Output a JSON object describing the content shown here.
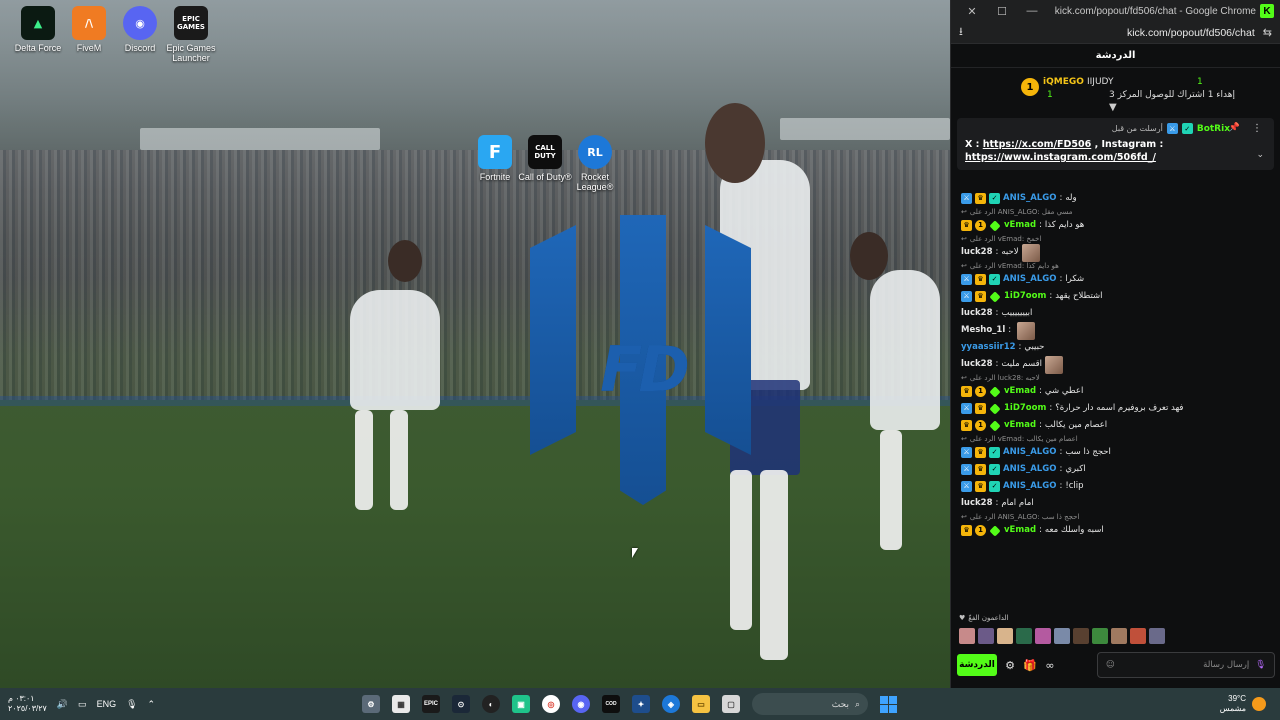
{
  "desktop": {
    "icons": [
      {
        "label": "Delta Force",
        "glyph": "▲"
      },
      {
        "label": "FiveM",
        "glyph": "/\\"
      },
      {
        "label": "Discord",
        "glyph": "◉"
      },
      {
        "label": "Epic Games Launcher",
        "glyph": "EPIC GAMES"
      }
    ],
    "center_icons": [
      {
        "label": "Fortnite",
        "glyph": "F"
      },
      {
        "label": "Call of Duty®",
        "glyph": "CALL DUTY"
      },
      {
        "label": "Rocket League®",
        "glyph": "RL"
      }
    ],
    "logo_text": "FD"
  },
  "browser": {
    "title": "kick.com/popout/fd506/chat - Google Chrome",
    "url": "kick.com/popout/fd506/chat",
    "title_badge": "K"
  },
  "chat": {
    "header": "الدردشة",
    "leaderboard": {
      "rank": "1",
      "user1": "iQMEGO",
      "user1_count": "1",
      "user2": "IIJUDY",
      "user2_count": "1",
      "goal": "إهداء 1 اشتراك للوصول المركز 3"
    },
    "pinned": {
      "pinned_by": "أرسلت من قبل",
      "bot_name": "BotRix",
      "line1_prefix": "X : ",
      "line1_link": "https://x.com/FD506",
      "line1_suffix": " , Instagram :",
      "line2_link": "https://www.instagram.com/506fd_/"
    },
    "messages": [
      {
        "reply": "",
        "user": "ANIS_ALGO",
        "text": "وله",
        "color": "#3a9be8",
        "badges": [
          "mod",
          "crown",
          "bot"
        ],
        "emote": false
      },
      {
        "reply": "الرد على ANIS_ALGO: مسي مقل",
        "user": "vEmad",
        "text": "هو دايم كذا",
        "color": "#53fc18",
        "badges": [
          "crown",
          "one",
          "gift"
        ],
        "emote": false
      },
      {
        "reply": "الرد على vEmad: اخمخ",
        "user": "luck28",
        "text": "لاحبه",
        "color": "#e6e6e6",
        "badges": [],
        "emote": true
      },
      {
        "reply": "الرد على vEmad: هو دايم كذا",
        "user": "ANIS_ALGO",
        "text": "شكرا",
        "color": "#3a9be8",
        "badges": [
          "mod",
          "crown",
          "bot"
        ],
        "emote": false
      },
      {
        "reply": "",
        "user": "1iD7oom",
        "text": "اشتطلاح يقهد",
        "color": "#53fc18",
        "badges": [
          "mod",
          "crown",
          "gift"
        ],
        "emote": false
      },
      {
        "reply": "",
        "user": "luck28",
        "text": "ابيييييييب",
        "color": "#e6e6e6",
        "badges": [],
        "emote": false
      },
      {
        "reply": "",
        "user": "Mesho_1l",
        "text": "",
        "color": "#e6e6e6",
        "badges": [],
        "emote": true
      },
      {
        "reply": "",
        "user": "yyaassiir12",
        "text": "حبيبي",
        "color": "#3a9be8",
        "badges": [],
        "emote": false
      },
      {
        "reply": "",
        "user": "luck28",
        "text": "اقسم مليت",
        "color": "#e6e6e6",
        "badges": [],
        "emote": true
      },
      {
        "reply": "الرد على luck28: لاحبه",
        "user": "vEmad",
        "text": "اعطي شي",
        "color": "#53fc18",
        "badges": [
          "crown",
          "one",
          "gift"
        ],
        "emote": false
      },
      {
        "reply": "",
        "user": "1iD7oom",
        "text": "فهد تعرف بروفيرم اسمه دار حرارة؟",
        "color": "#53fc18",
        "badges": [
          "mod",
          "crown",
          "gift"
        ],
        "emote": false
      },
      {
        "reply": "",
        "user": "vEmad",
        "text": "اعصام مين يكالب",
        "color": "#53fc18",
        "badges": [
          "crown",
          "one",
          "gift"
        ],
        "emote": false
      },
      {
        "reply": "الرد على vEmad: اعصام مين يكالب",
        "user": "ANIS_ALGO",
        "text": "احجج ذا سب",
        "color": "#3a9be8",
        "badges": [
          "mod",
          "crown",
          "bot"
        ],
        "emote": false
      },
      {
        "reply": "",
        "user": "ANIS_ALGO",
        "text": "اكبري",
        "color": "#3a9be8",
        "badges": [
          "mod",
          "crown",
          "bot"
        ],
        "emote": false
      },
      {
        "reply": "",
        "user": "ANIS_ALGO",
        "text": "!clip",
        "color": "#3a9be8",
        "badges": [
          "mod",
          "crown",
          "bot"
        ],
        "emote": false
      },
      {
        "reply": "",
        "user": "luck28",
        "text": "امام امام",
        "color": "#e6e6e6",
        "badges": [],
        "emote": false
      },
      {
        "reply": "الرد على ANIS_ALGO: احجج ذا سب",
        "user": "vEmad",
        "text": "اسبه واسلك معه",
        "color": "#53fc18",
        "badges": [
          "crown",
          "one",
          "gift"
        ],
        "emote": false
      }
    ],
    "top_label": "الداعمون الفعّ",
    "input_placeholder": "إرسال رسالة",
    "send_label": "الدردشة"
  },
  "taskbar": {
    "time": "٠٣:٠١ م",
    "date": "٢٠٢٥/٠٣/٢٧",
    "lang": "ENG",
    "search_placeholder": "بحث",
    "temp": "39°C",
    "weather": "مشمس"
  },
  "colors": {
    "kick_green": "#53fc18",
    "mod_blue": "#3a9be8",
    "gold": "#f5b50a"
  }
}
